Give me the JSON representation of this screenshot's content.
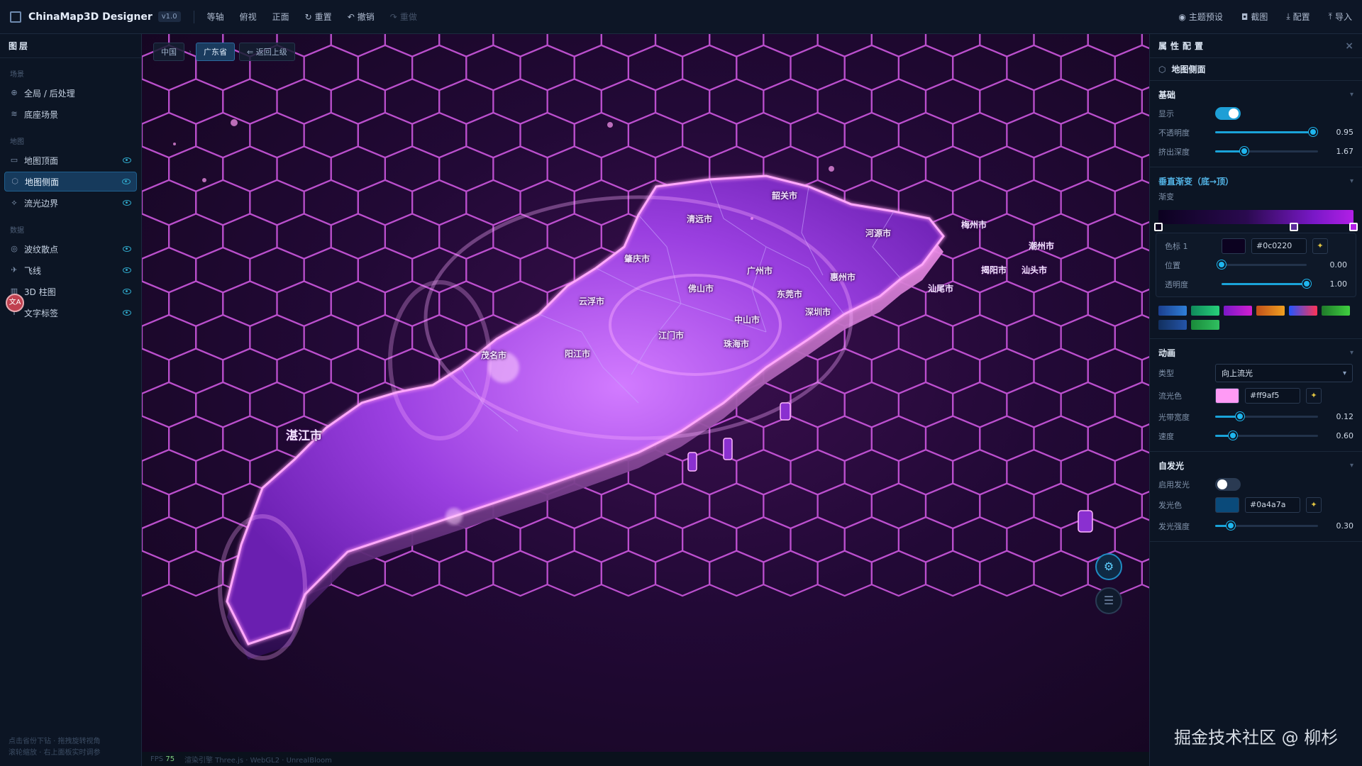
{
  "app": {
    "title": "ChinaMap3D Designer",
    "version": "v1.0"
  },
  "toolbar": {
    "left": [
      {
        "label": "等轴",
        "icon": ""
      },
      {
        "label": "俯视",
        "icon": ""
      },
      {
        "label": "正面",
        "icon": ""
      },
      {
        "label": "重置",
        "icon": "↻"
      },
      {
        "label": "撤销",
        "icon": "↶"
      },
      {
        "label": "重做",
        "icon": "↷"
      }
    ],
    "right": [
      {
        "label": "主题预设",
        "icon": "◉"
      },
      {
        "label": "截图",
        "icon": "◘"
      },
      {
        "label": "配置",
        "icon": "⤓"
      },
      {
        "label": "导入",
        "icon": "⤒"
      }
    ]
  },
  "layers_panel": {
    "title": "图层",
    "groups": [
      {
        "title": "场景",
        "items": [
          {
            "label": "全局 / 后处理",
            "icon": "⊕"
          },
          {
            "label": "底座场景",
            "icon": "≋"
          }
        ]
      },
      {
        "title": "地图",
        "items": [
          {
            "label": "地图顶面",
            "icon": "▭"
          },
          {
            "label": "地图侧面",
            "icon": "⬡",
            "active": true
          },
          {
            "label": "流光边界",
            "icon": "⟡"
          }
        ]
      },
      {
        "title": "数据",
        "items": [
          {
            "label": "波纹散点",
            "icon": "◎"
          },
          {
            "label": "飞线",
            "icon": "✈"
          },
          {
            "label": "3D 柱图",
            "icon": "▥"
          },
          {
            "label": "文字标签",
            "icon": "T"
          }
        ]
      }
    ],
    "footer": [
      "点击省份下钻 · 拖拽旋转视角",
      "滚轮缩放 · 右上面板实时调参"
    ]
  },
  "translate_badge": "文A",
  "breadcrumb": {
    "root": "中国",
    "current": "广东省",
    "back": "⇐ 返回上级"
  },
  "map_labels": [
    {
      "name": "韶关市"
    },
    {
      "name": "清远市"
    },
    {
      "name": "河源市"
    },
    {
      "name": "梅州市"
    },
    {
      "name": "潮州市"
    },
    {
      "name": "肇庆市"
    },
    {
      "name": "广州市"
    },
    {
      "name": "惠州市"
    },
    {
      "name": "揭阳市"
    },
    {
      "name": "汕头市"
    },
    {
      "name": "佛山市"
    },
    {
      "name": "东莞市"
    },
    {
      "name": "汕尾市"
    },
    {
      "name": "云浮市"
    },
    {
      "name": "深圳市"
    },
    {
      "name": "中山市"
    },
    {
      "name": "江门市"
    },
    {
      "name": "珠海市"
    },
    {
      "name": "阳江市"
    },
    {
      "name": "茂名市"
    },
    {
      "name": "湛江市"
    }
  ],
  "float_buttons": {
    "settings_icon": "⚙",
    "data_icon": "☰"
  },
  "status": {
    "fps_label": "FPS",
    "fps": "75",
    "engine": "渲染引擎 Three.js · WebGL2 · UnrealBloom"
  },
  "watermark": "掘金技术社区 @ 柳杉",
  "props_panel": {
    "title": "属性配置",
    "close_icon": "×",
    "subject": "地图侧面",
    "basic": {
      "title": "基础",
      "show_label": "显示",
      "show_on": true,
      "opacity_label": "不透明度",
      "opacity": 0.95,
      "opacity_text": "0.95",
      "depth_label": "挤出深度",
      "depth_frac": 0.28,
      "depth_text": "1.67"
    },
    "gradient": {
      "title": "垂直渐变（底→顶）",
      "label": "渐变",
      "stop_label": "色标 1",
      "stop_color": "#0c0220",
      "pos_label": "位置",
      "pos": 0.0,
      "pos_text": "0.00",
      "alpha_label": "透明度",
      "alpha": 1.0,
      "alpha_text": "1.00",
      "stop_colors": [
        "#0c0220",
        "#5a2a9a",
        "#b21fe6"
      ],
      "presets": [
        [
          "#1b3f8f",
          "#2f7fd8"
        ],
        [
          "#0f8a5a",
          "#27d07a"
        ],
        [
          "#7a18c8",
          "#d21fd0"
        ],
        [
          "#c2501a",
          "#f0a020"
        ],
        [
          "#2255ff",
          "#ff3355"
        ],
        [
          "#1f7a2a",
          "#40d040"
        ],
        [
          "#12305f",
          "#2454a8"
        ],
        [
          "#1a8a3a",
          "#30c060"
        ]
      ]
    },
    "animation": {
      "title": "动画",
      "type_label": "类型",
      "type_value": "向上流光",
      "color_label": "流光色",
      "color": "#ff9af5",
      "band_label": "光带宽度",
      "band_frac": 0.24,
      "band_text": "0.12",
      "speed_label": "速度",
      "speed_frac": 0.17,
      "speed_text": "0.60"
    },
    "emissive": {
      "title": "自发光",
      "enable_label": "启用发光",
      "enabled": false,
      "color_label": "发光色",
      "color": "#0a4a7a",
      "intensity_label": "发光强度",
      "intensity_frac": 0.15,
      "intensity_text": "0.30"
    }
  }
}
